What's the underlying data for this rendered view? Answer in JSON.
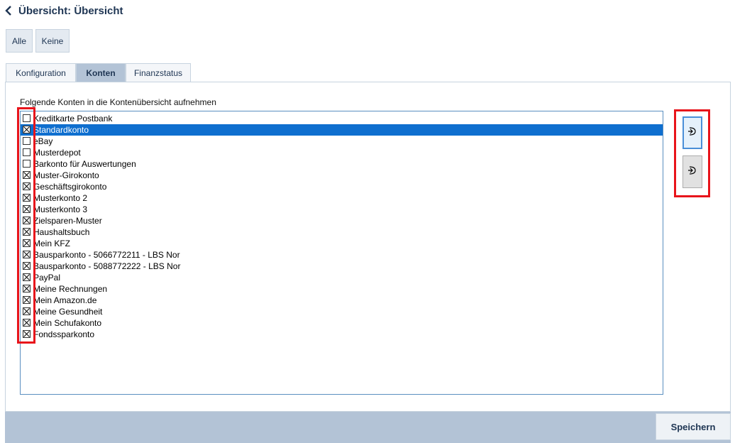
{
  "header": {
    "back_icon": "chevron-left-icon",
    "title": "Übersicht: Übersicht"
  },
  "selection": {
    "all_label": "Alle",
    "none_label": "Keine"
  },
  "tabs": [
    {
      "label": "Konfiguration",
      "active": false
    },
    {
      "label": "Konten",
      "active": true
    },
    {
      "label": "Finanzstatus",
      "active": false
    }
  ],
  "panel": {
    "label": "Folgende Konten in die Kontenübersicht aufnehmen"
  },
  "accounts": [
    {
      "label": "Kreditkarte Postbank",
      "checked": false,
      "selected": false
    },
    {
      "label": "Standardkonto",
      "checked": true,
      "selected": true
    },
    {
      "label": "eBay",
      "checked": false,
      "selected": false
    },
    {
      "label": "Musterdepot",
      "checked": false,
      "selected": false
    },
    {
      "label": "Barkonto für Auswertungen",
      "checked": false,
      "selected": false
    },
    {
      "label": "Muster-Girokonto",
      "checked": true,
      "selected": false
    },
    {
      "label": "Geschäftsgirokonto",
      "checked": true,
      "selected": false
    },
    {
      "label": "Musterkonto 2",
      "checked": true,
      "selected": false
    },
    {
      "label": "Musterkonto 3",
      "checked": true,
      "selected": false
    },
    {
      "label": "Zielsparen-Muster",
      "checked": true,
      "selected": false
    },
    {
      "label": "Haushaltsbuch",
      "checked": true,
      "selected": false
    },
    {
      "label": "Mein KFZ",
      "checked": true,
      "selected": false
    },
    {
      "label": "Bausparkonto - 5066772211 - LBS Nor",
      "checked": true,
      "selected": false
    },
    {
      "label": "Bausparkonto - 5088772222 - LBS Nor",
      "checked": true,
      "selected": false
    },
    {
      "label": "PayPal",
      "checked": true,
      "selected": false
    },
    {
      "label": "Meine Rechnungen",
      "checked": true,
      "selected": false
    },
    {
      "label": "Mein Amazon.de",
      "checked": true,
      "selected": false
    },
    {
      "label": "Meine Gesundheit",
      "checked": true,
      "selected": false
    },
    {
      "label": "Mein Schufakonto",
      "checked": true,
      "selected": false
    },
    {
      "label": "Fondssparkonto",
      "checked": true,
      "selected": false
    }
  ],
  "side_buttons": {
    "up_icon": "move-up-icon",
    "down_icon": "move-down-icon"
  },
  "footer": {
    "save_label": "Speichern"
  },
  "colors": {
    "highlight": "#e8141b",
    "selection": "#0f6fcf",
    "accent_panel": "#b3c3d6"
  }
}
